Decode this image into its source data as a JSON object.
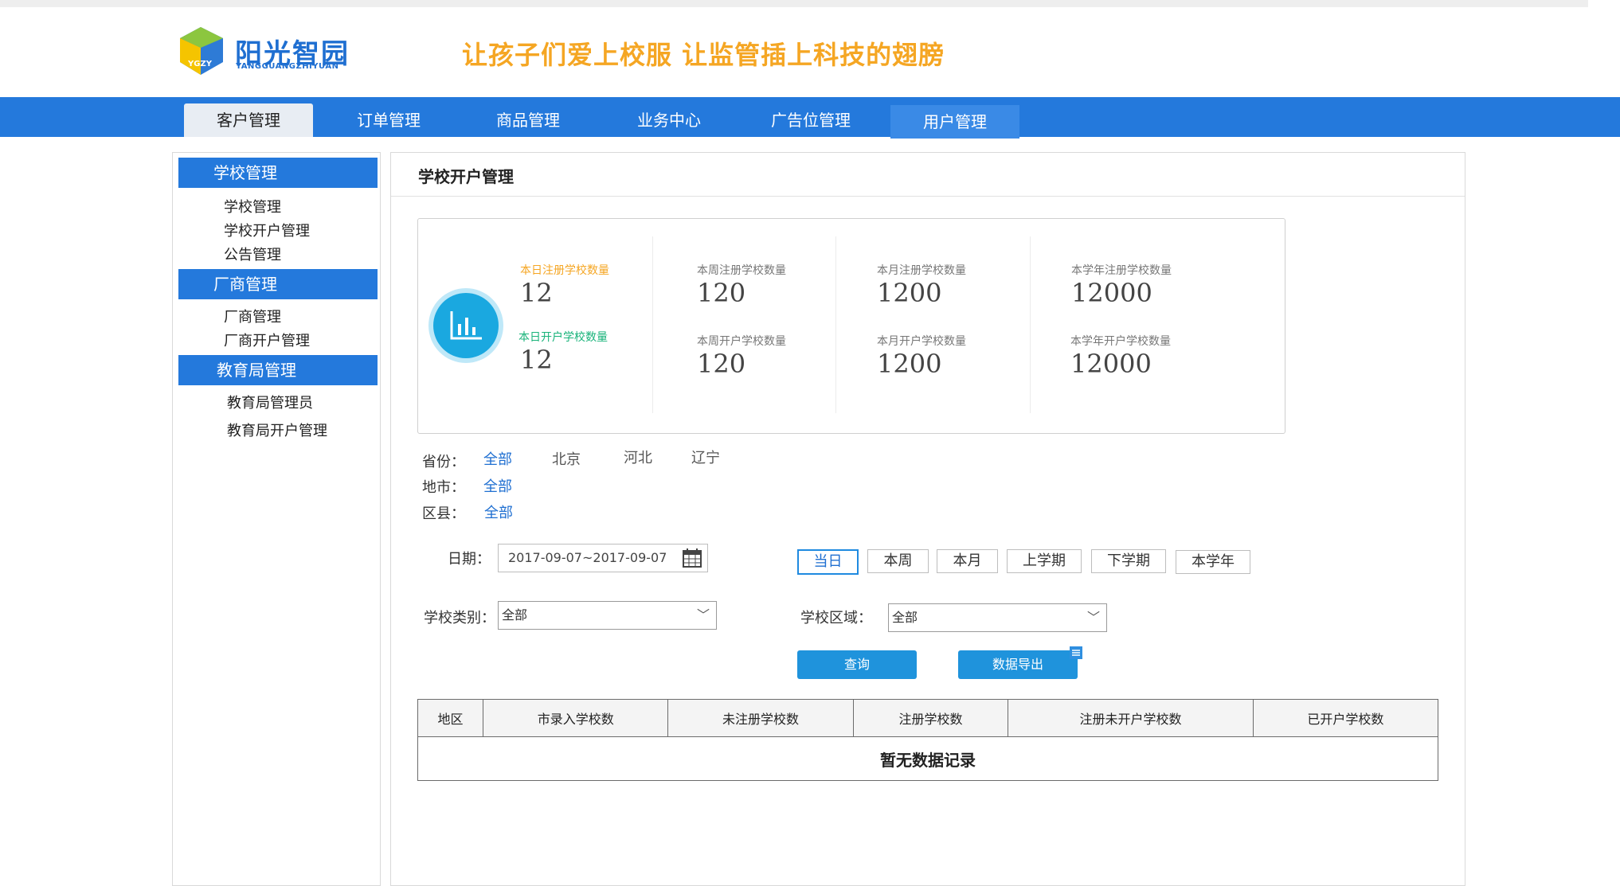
{
  "header": {
    "logo_text": "阳光智园",
    "logo_sub": "YANGGUANGZHIYUAN",
    "logo_badge": "YGZY",
    "slogan": "让孩子们爱上校服  让监管插上科技的翅膀"
  },
  "nav": {
    "tabs": [
      {
        "label": "客户管理"
      },
      {
        "label": "订单管理"
      },
      {
        "label": "商品管理"
      },
      {
        "label": "业务中心"
      },
      {
        "label": "广告位管理"
      },
      {
        "label": "用户管理"
      }
    ]
  },
  "sidebar": {
    "groups": [
      {
        "title": "学校管理",
        "items": [
          "学校管理",
          "学校开户管理",
          "公告管理"
        ]
      },
      {
        "title": "厂商管理",
        "items": [
          "厂商管理",
          "厂商开户管理"
        ]
      },
      {
        "title": "教育局管理",
        "items": [
          "教育局管理员",
          "教育局开户管理"
        ]
      }
    ]
  },
  "main": {
    "title": "学校开户管理",
    "stats": {
      "today_reg_label": "本日注册学校数量",
      "today_reg_value": "12",
      "today_open_label": "本日开户学校数量",
      "today_open_value": "12",
      "week_reg_label": "本周注册学校数量",
      "week_reg_value": "120",
      "week_open_label": "本周开户学校数量",
      "week_open_value": "120",
      "month_reg_label": "本月注册学校数量",
      "month_reg_value": "1200",
      "month_open_label": "本月开户学校数量",
      "month_open_value": "1200",
      "year_reg_label": "本学年注册学校数量",
      "year_reg_value": "12000",
      "year_open_label": "本学年开户学校数量",
      "year_open_value": "12000"
    },
    "filters": {
      "province_label": "省份：",
      "province_options": [
        "全部",
        "北京",
        "河北",
        "辽宁"
      ],
      "city_label": "地市：",
      "city_option": "全部",
      "district_label": "区县：",
      "district_option": "全部"
    },
    "date": {
      "label": "日期：",
      "value": "2017-09-07~2017-09-07"
    },
    "periods": [
      "当日",
      "本周",
      "本月",
      "上学期",
      "下学期",
      "本学年"
    ],
    "school_type": {
      "label": "学校类别：",
      "value": "全部"
    },
    "school_area": {
      "label": "学校区域：",
      "value": "全部"
    },
    "buttons": {
      "query": "查询",
      "export": "数据导出"
    },
    "table": {
      "headers": [
        "地区",
        "市录入学校数",
        "未注册学校数",
        "注册学校数",
        "注册未开户学校数",
        "已开户学校数"
      ],
      "empty_text": "暂无数据记录"
    }
  },
  "colors": {
    "nav_blue": "#2479dc",
    "accent_orange": "#f5a623",
    "accent_green": "#19b37a",
    "link_blue": "#1f6fd1",
    "button_blue": "#1f93dc"
  }
}
